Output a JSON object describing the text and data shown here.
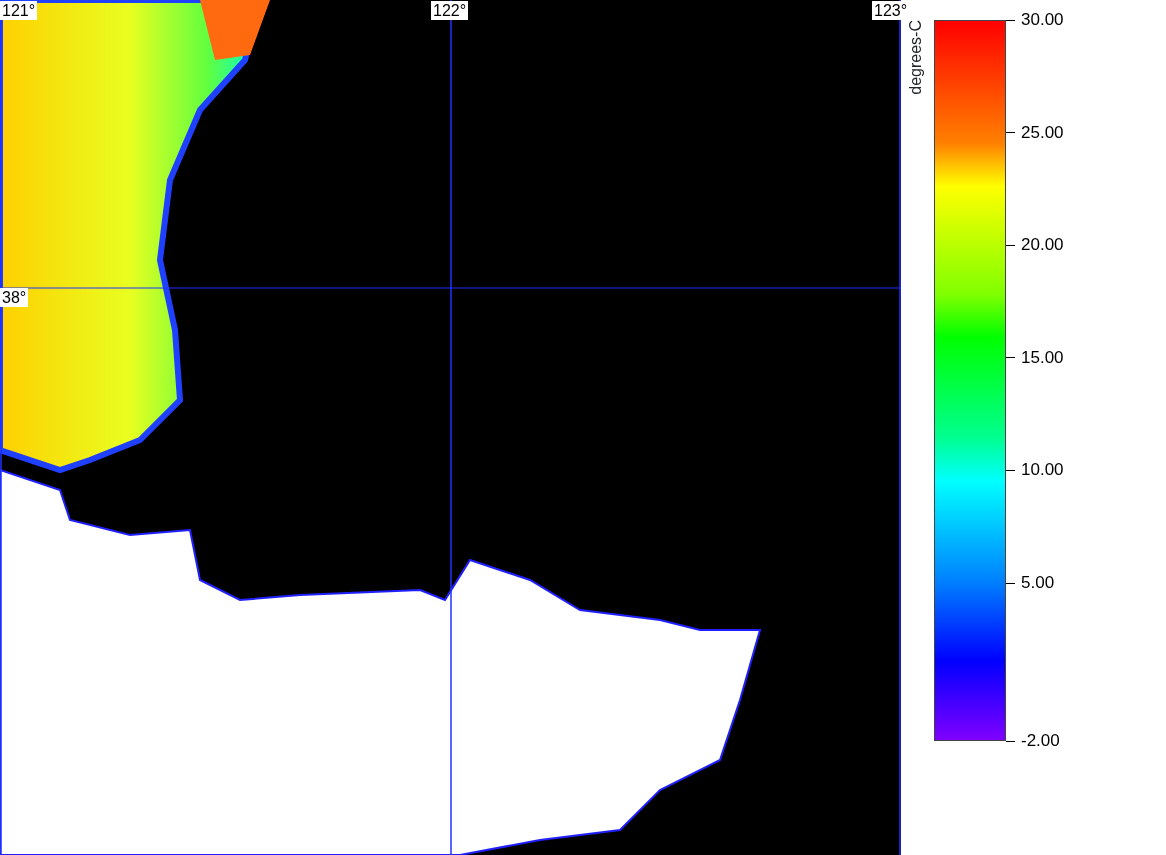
{
  "map": {
    "longitude_labels": [
      "121°",
      "122°",
      "123°"
    ],
    "latitude_labels": [
      "38°"
    ]
  },
  "colorbar": {
    "title": "degrees-C",
    "tick_labels": [
      "30.00",
      "25.00",
      "20.00",
      "15.00",
      "10.00",
      "5.00",
      "-2.00"
    ]
  }
}
